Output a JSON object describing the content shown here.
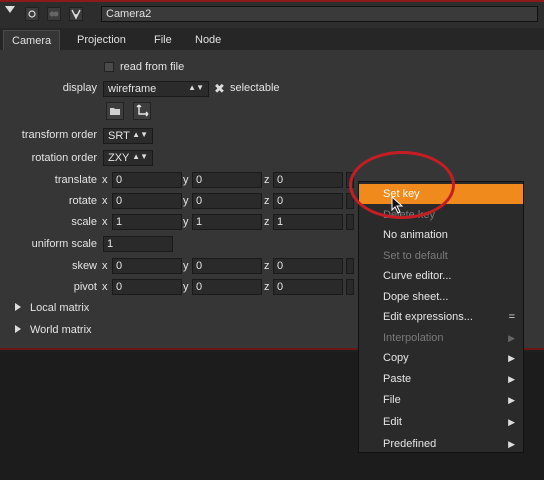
{
  "header": {
    "node_name": "Camera2"
  },
  "tabs": [
    "Camera",
    "Projection",
    "File",
    "Node"
  ],
  "camera": {
    "read_from_file_label": "read from file",
    "display_label": "display",
    "display_value": "wireframe",
    "selectable_label": "selectable",
    "transform_order_label": "transform order",
    "transform_order_value": "SRT",
    "rotation_order_label": "rotation order",
    "rotation_order_value": "ZXY",
    "rows": [
      {
        "label": "translate",
        "x": "0",
        "y": "0",
        "z": "0"
      },
      {
        "label": "rotate",
        "x": "0",
        "y": "0",
        "z": "0"
      },
      {
        "label": "scale",
        "x": "1",
        "y": "1",
        "z": "1"
      }
    ],
    "uniform_scale_label": "uniform scale",
    "uniform_scale_value": "1",
    "rows2": [
      {
        "label": "skew",
        "x": "0",
        "y": "0",
        "z": "0"
      },
      {
        "label": "pivot",
        "x": "0",
        "y": "0",
        "z": "0"
      }
    ],
    "axis": {
      "x": "x",
      "y": "y",
      "z": "z"
    },
    "local_matrix": "Local matrix",
    "world_matrix": "World matrix"
  },
  "menu": {
    "items": [
      {
        "label": "Set key",
        "state": "highlighted"
      },
      {
        "label": "Delete key",
        "state": "disabled"
      },
      {
        "label": "No animation",
        "state": "enabled"
      },
      {
        "label": "Set to default",
        "state": "disabled"
      },
      {
        "label": "Curve editor...",
        "state": "enabled"
      },
      {
        "label": "Dope sheet...",
        "state": "enabled"
      },
      {
        "label": "Edit expressions...",
        "state": "enabled",
        "shortcut": "="
      },
      {
        "label": "Interpolation",
        "state": "disabled",
        "submenu": true
      },
      {
        "label": "Copy",
        "state": "enabled",
        "submenu": true
      },
      {
        "label": "Paste",
        "state": "enabled",
        "submenu": true
      },
      {
        "label": "File",
        "state": "enabled",
        "submenu": true
      },
      {
        "label": "Edit",
        "state": "enabled",
        "submenu": true
      },
      {
        "label": "Predefined",
        "state": "enabled",
        "submenu": true
      }
    ]
  },
  "colors": {
    "highlight": "#f08a1c",
    "annotation_ring": "#c41e24",
    "accent_line": "#8b1a1a"
  },
  "icons": [
    "collapse-arrow-icon",
    "circle-icon",
    "group-icon",
    "node-type-icon",
    "folder-icon",
    "move-axes-icon",
    "checkmark-x-icon",
    "mouse-cursor-icon"
  ]
}
